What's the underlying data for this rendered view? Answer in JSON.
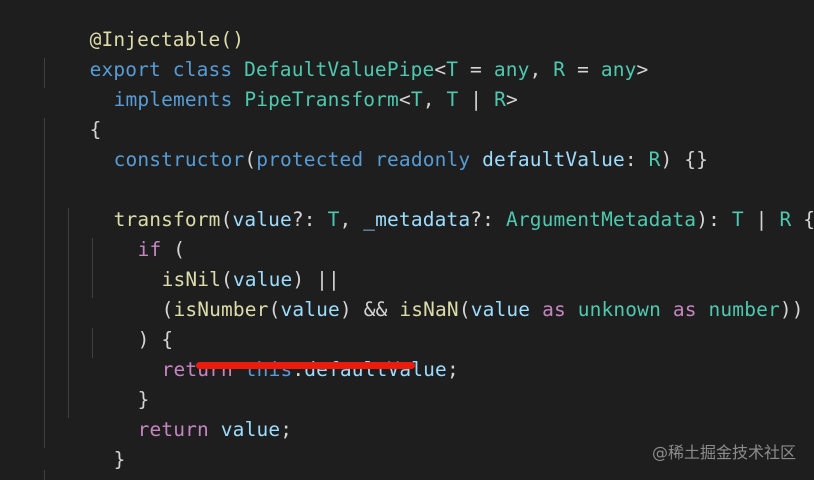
{
  "colors": {
    "background": "#1e1e1e",
    "keyword_control": "#c586c0",
    "keyword_storage": "#569cd6",
    "type": "#4ec9b0",
    "function": "#dcdcaa",
    "variable": "#9cdcfe",
    "punctuation": "#d4d4d4",
    "annotation_underline": "#ec1c0c"
  },
  "code": {
    "l1": [
      "@Injectable()"
    ],
    "l2": [
      "export",
      " ",
      "class",
      " ",
      "DefaultValuePipe",
      "<",
      "T",
      " = ",
      "any",
      ", ",
      "R",
      " = ",
      "any",
      ">"
    ],
    "l3": [
      "implements",
      " ",
      "PipeTransform",
      "<",
      "T",
      ", ",
      "T",
      " | ",
      "R",
      ">"
    ],
    "l4": [
      "{"
    ],
    "l5": [
      "constructor",
      "(",
      "protected",
      " ",
      "readonly",
      " ",
      "defaultValue",
      ": ",
      "R",
      ") {}"
    ],
    "l7": [
      "transform",
      "(",
      "value",
      "?: ",
      "T",
      ", ",
      "_metadata",
      "?: ",
      "ArgumentMetadata",
      "): ",
      "T",
      " | ",
      "R",
      " {"
    ],
    "l8": [
      "if",
      " ("
    ],
    "l9": [
      "isNil",
      "(",
      "value",
      ") ||"
    ],
    "l10": [
      "(",
      "isNumber",
      "(",
      "value",
      ") && ",
      "isNaN",
      "(",
      "value",
      " ",
      "as",
      " ",
      "unknown",
      " ",
      "as",
      " ",
      "number",
      "))"
    ],
    "l11": [
      ") {"
    ],
    "l12": [
      "return",
      " ",
      "this",
      ".",
      "defaultValue",
      ";"
    ],
    "l13": [
      "}"
    ],
    "l14": [
      "return",
      " ",
      "value",
      ";"
    ],
    "l15": [
      "}"
    ],
    "l16": [
      "}"
    ]
  },
  "watermark": "@稀土掘金技术社区"
}
